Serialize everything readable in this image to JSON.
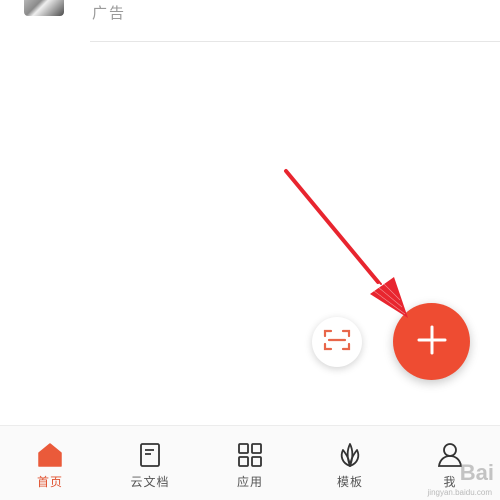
{
  "ad": {
    "label": "广告"
  },
  "nav": {
    "items": [
      {
        "label": "首页",
        "icon": "home-icon",
        "active": true
      },
      {
        "label": "云文档",
        "icon": "document-icon",
        "active": false
      },
      {
        "label": "应用",
        "icon": "apps-grid-icon",
        "active": false
      },
      {
        "label": "模板",
        "icon": "leaf-icon",
        "active": false
      },
      {
        "label": "我",
        "icon": "person-icon",
        "active": false
      }
    ]
  },
  "fab": {
    "add_icon": "plus-icon",
    "scan_icon": "scan-icon"
  },
  "watermark": {
    "brand": "Bai",
    "url": "jingyan.baidu.com"
  },
  "colors": {
    "accent": "#ee4c32",
    "annotation_arrow": "#e8252f",
    "nav_active": "#e0512f"
  }
}
